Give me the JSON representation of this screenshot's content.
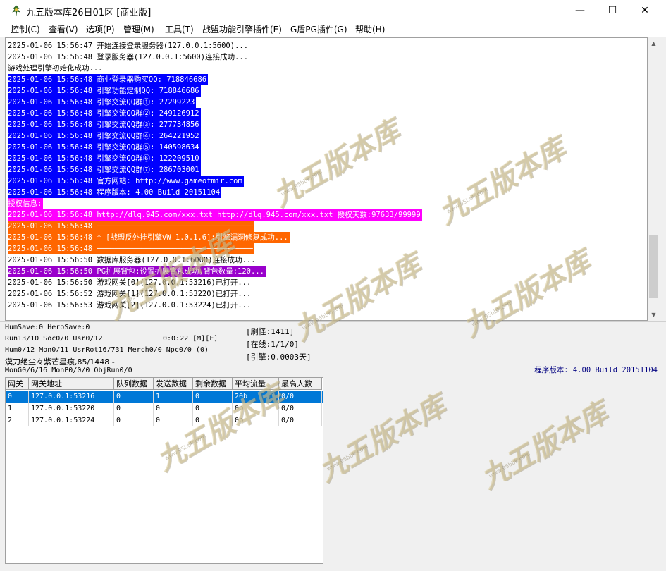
{
  "window": {
    "title": "九五版本库26日01区 [商业版]",
    "controls": {
      "minimize": "—",
      "maximize": "☐",
      "close": "✕"
    }
  },
  "menu": [
    "控制(C)",
    "查看(V)",
    "选项(P)",
    "管理(M)",
    "工具(T)",
    "战盟功能引擎插件(E)",
    "G盾PG插件(G)",
    "帮助(H)"
  ],
  "log_lines": [
    {
      "text": "2025-01-06 15:56:47 开始连接登录服务器(127.0.0.1:5600)...",
      "fg": "#000000",
      "bg": ""
    },
    {
      "text": "2025-01-06 15:56:48 登录服务器(127.0.0.1:5600)连接成功...",
      "fg": "#000000",
      "bg": ""
    },
    {
      "text": "游戏处理引擎初始化成功...",
      "fg": "#000000",
      "bg": ""
    },
    {
      "text": "2025-01-06 15:56:48 商业登录器购买QQ: 718846686",
      "fg": "#ffffff",
      "bg": "#0000ff"
    },
    {
      "text": "2025-01-06 15:56:48 引擎功能定制QQ: 718846686",
      "fg": "#ffffff",
      "bg": "#0000ff"
    },
    {
      "text": "2025-01-06 15:56:48 引擎交流QQ群①: 27299223",
      "fg": "#ffffff",
      "bg": "#0000ff"
    },
    {
      "text": "2025-01-06 15:56:48 引擎交流QQ群②: 249126912",
      "fg": "#ffffff",
      "bg": "#0000ff"
    },
    {
      "text": "2025-01-06 15:56:48 引擎交流QQ群③: 277734856",
      "fg": "#ffffff",
      "bg": "#0000ff"
    },
    {
      "text": "2025-01-06 15:56:48 引擎交流QQ群④: 264221952",
      "fg": "#ffffff",
      "bg": "#0000ff"
    },
    {
      "text": "2025-01-06 15:56:48 引擎交流QQ群⑤: 140598634",
      "fg": "#ffffff",
      "bg": "#0000ff"
    },
    {
      "text": "2025-01-06 15:56:48 引擎交流QQ群⑥: 122209510",
      "fg": "#ffffff",
      "bg": "#0000ff"
    },
    {
      "text": "2025-01-06 15:56:48 引擎交流QQ群⑦: 286703001",
      "fg": "#ffffff",
      "bg": "#0000ff"
    },
    {
      "text": "2025-01-06 15:56:48 官方网站: http://www.gameofmir.com",
      "fg": "#ffffff",
      "bg": "#0000ff"
    },
    {
      "text": "2025-01-06 15:56:48 程序版本: 4.00 Build 20151104",
      "fg": "#ffffff",
      "bg": "#0000ff"
    },
    {
      "text": "授权信息:",
      "fg": "#ffffff",
      "bg": "#ff00ff"
    },
    {
      "text": "2025-01-06 15:56:48 http://dlq.945.com/xxx.txt http://dlq.945.com/xxx.txt 授权天数:97633/99999",
      "fg": "#ffffff",
      "bg": "#ff00ff"
    },
    {
      "text": "2025-01-06 15:56:48 ───────────────────────────────────",
      "fg": "#ffffff",
      "bg": "#ff6600"
    },
    {
      "text": "2025-01-06 15:56:48 * [战盟反外挂引擎vW 1.0.1.6]:引擎漏洞修复成功...",
      "fg": "#ffffff",
      "bg": "#ff6600"
    },
    {
      "text": "2025-01-06 15:56:48 ───────────────────────────────────",
      "fg": "#ffffff",
      "bg": "#ff6600"
    },
    {
      "text": "2025-01-06 15:56:50 数据库服务器(127.0.0.1:6000)连接成功...",
      "fg": "#000000",
      "bg": ""
    },
    {
      "text": "2025-01-06 15:56:50 PG扩展背包:设置扩展背包成功,背包数量:120...",
      "fg": "#ffffff",
      "bg": "#9900cc"
    },
    {
      "text": "2025-01-06 15:56:50 游戏网关[0](127.0.0.1:53216)已打开...",
      "fg": "#000000",
      "bg": ""
    },
    {
      "text": "2025-01-06 15:56:52 游戏网关[1](127.0.0.1:53220)已打开...",
      "fg": "#000000",
      "bg": ""
    },
    {
      "text": "2025-01-06 15:56:53 游戏网关[2](127.0.0.1:53224)已打开...",
      "fg": "#000000",
      "bg": ""
    }
  ],
  "stats": {
    "line1": "HumSave:0 HeroSave:0",
    "line2": "Run13/10 Soc0/0 Usr0/12",
    "time": "0:0:22 [M][F]",
    "line3": "Hum0/12 Mon0/11 UsrRot16/731 Merch0/0 Npc0/0 (0)",
    "line4": "漠刀绝尘々紫芒星痕,85/1448 -",
    "line5": "MonG0/6/16 MonP0/0/0 ObjRun0/0",
    "refresh": "[刷怪:1411]",
    "online": "[在线:1/1/0]",
    "engine": "[引擎:0.0003天]",
    "version": "程序版本: 4.00 Build 20151104"
  },
  "table": {
    "headers": [
      "网关",
      "网关地址",
      "队列数据",
      "发送数据",
      "剩余数据",
      "平均流量",
      "最高人数"
    ],
    "rows": [
      [
        "0",
        "127.0.0.1:53216",
        "0",
        "1",
        "0",
        "20b",
        "0/0"
      ],
      [
        "1",
        "127.0.0.1:53220",
        "0",
        "0",
        "0",
        "0b",
        "0/0"
      ],
      [
        "2",
        "127.0.0.1:53224",
        "0",
        "0",
        "0",
        "0b",
        "0/0"
      ]
    ],
    "selected_row": 0
  },
  "watermark": {
    "main": "九五版本库",
    "sub": "www.95bbk.com"
  }
}
